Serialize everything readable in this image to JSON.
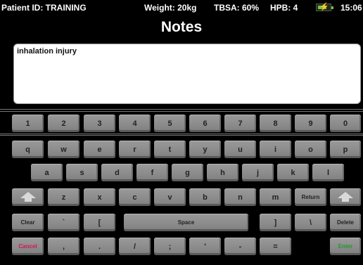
{
  "status": {
    "patient_id": "Patient ID: TRAINING",
    "weight": "Weight: 20kg",
    "tbsa": "TBSA: 60%",
    "hpb": "HPB: 4",
    "battery_level": 0.75,
    "battery_icon": "battery-charging-icon",
    "time": "15:06"
  },
  "title": "Notes",
  "notes_text": "inhalation injury",
  "keyboard": {
    "row1": [
      "1",
      "2",
      "3",
      "4",
      "5",
      "6",
      "7",
      "8",
      "9",
      "0"
    ],
    "row2": [
      "q",
      "w",
      "e",
      "r",
      "t",
      "y",
      "u",
      "i",
      "o",
      "p"
    ],
    "row3": [
      "a",
      "s",
      "d",
      "f",
      "g",
      "h",
      "j",
      "k",
      "l"
    ],
    "row4": [
      "z",
      "x",
      "c",
      "v",
      "b",
      "n",
      "m"
    ],
    "return": "Return",
    "shift_icon": "shift-arrow-icon",
    "clear": "Clear",
    "backtick": "`",
    "lbracket": "[",
    "space": "Space",
    "rbracket": "]",
    "backslash": "\\",
    "delete": "Delete",
    "cancel": "Cancel",
    "comma": ",",
    "period": ".",
    "slash": "/",
    "semicolon": ";",
    "quote": "'",
    "minus": "-",
    "equals": "=",
    "enter": "Enter"
  },
  "colors": {
    "cancel": "#d4145a",
    "enter": "#1d9b2a",
    "battery": "#7ac143"
  }
}
